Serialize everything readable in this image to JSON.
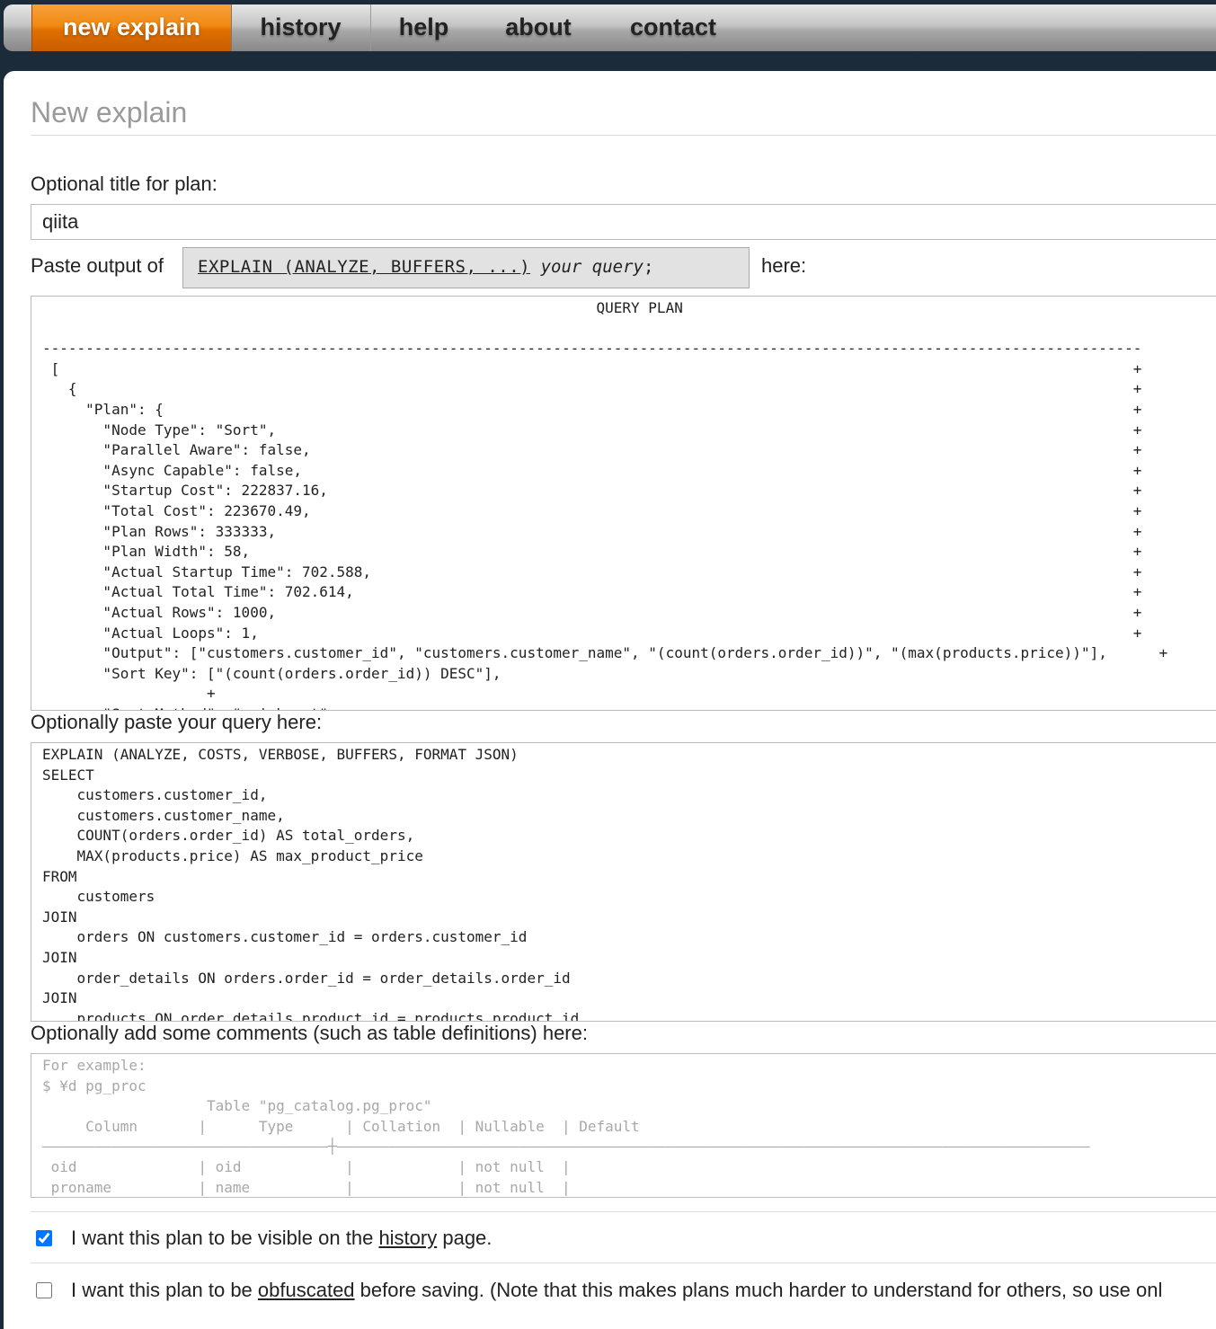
{
  "nav": {
    "tabs": [
      {
        "label": "new explain",
        "active": true
      },
      {
        "label": "history"
      },
      {
        "label": "help"
      },
      {
        "label": "about"
      },
      {
        "label": "contact"
      }
    ]
  },
  "page": {
    "title": "New explain",
    "plan_title_label": "Optional title for plan:",
    "plan_title_value": "qiita",
    "paste_prefix": "Paste output of",
    "explain_button": {
      "code": "EXPLAIN (ANALYZE, BUFFERS, ...)",
      "italic": "your query",
      "suffix": ";"
    },
    "paste_suffix": "here:",
    "query_label": "Optionally paste your query here:",
    "comments_label": "Optionally add some comments (such as table definitions) here:"
  },
  "plan_text": "                                                                QUERY PLAN\n\n-------------------------------------------------------------------------------------------------------------------------------\n [                                                                                                                            +\n   {                                                                                                                          +\n     \"Plan\": {                                                                                                                +\n       \"Node Type\": \"Sort\",                                                                                                   +\n       \"Parallel Aware\": false,                                                                                               +\n       \"Async Capable\": false,                                                                                                +\n       \"Startup Cost\": 222837.16,                                                                                             +\n       \"Total Cost\": 223670.49,                                                                                               +\n       \"Plan Rows\": 333333,                                                                                                   +\n       \"Plan Width\": 58,                                                                                                      +\n       \"Actual Startup Time\": 702.588,                                                                                        +\n       \"Actual Total Time\": 702.614,                                                                                          +\n       \"Actual Rows\": 1000,                                                                                                   +\n       \"Actual Loops\": 1,                                                                                                     +\n       \"Output\": [\"customers.customer_id\", \"customers.customer_name\", \"(count(orders.order_id))\", \"(max(products.price))\"],      +\n       \"Sort Key\": [\"(count(orders.order_id)) DESC\"],\n                   +\n       \"Sort Method\": \"quicksort\",",
  "query_text": "EXPLAIN (ANALYZE, COSTS, VERBOSE, BUFFERS, FORMAT JSON)\nSELECT\n    customers.customer_id,\n    customers.customer_name,\n    COUNT(orders.order_id) AS total_orders,\n    MAX(products.price) AS max_product_price\nFROM\n    customers\nJOIN\n    orders ON customers.customer_id = orders.customer_id\nJOIN\n    order_details ON orders.order_id = order_details.order_id\nJOIN\n    products ON order_details.product_id = products.product_id",
  "comments_placeholder": "For example:\n$ ¥d pg_proc\n                   Table \"pg_catalog.pg_proc\"\n     Column       |      Type      | Collation  | Nullable  | Default\n―――――――――――――――――――――――――――――――――┼―――――――――――――――――――――――――――――――――――――――――――――――――――――――――――――――――――――――――――――――――――――――\n oid              | oid            |            | not null  |\n proname          | name           |            | not null  |",
  "options": {
    "visible": {
      "checked": true,
      "before": "I want this plan to be visible on the ",
      "link": "history",
      "after": " page."
    },
    "obfuscate": {
      "checked": false,
      "before": "I want this plan to be ",
      "link": "obfuscated",
      "after": " before saving. (Note that this makes plans much harder to understand for others, so use onl"
    }
  }
}
